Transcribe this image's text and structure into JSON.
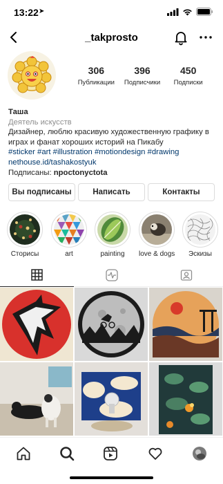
{
  "status": {
    "time": "13:22"
  },
  "header": {
    "username": "_takprosto"
  },
  "profile": {
    "stats": [
      {
        "value": "306",
        "label": "Публикации"
      },
      {
        "value": "396",
        "label": "Подписчики"
      },
      {
        "value": "450",
        "label": "Подписки"
      }
    ],
    "name": "Таша",
    "category": "Деятель искусств",
    "bio_line1": "Дизайнер, люблю красивую художественную графику в",
    "bio_line2": "играх и фанат хороших историй на Пикабу",
    "hashtags": "#sticker #art #illustration #motiondesign #drawing",
    "link": "nethouse.id/tashakostyuk",
    "followed_by_prefix": "Подписаны: ",
    "followed_by_user": "npoctonyctota"
  },
  "actions": {
    "following": "Вы подписаны",
    "message": "Написать",
    "contacts": "Контакты"
  },
  "highlights": [
    {
      "label": "Сторисы"
    },
    {
      "label": "art"
    },
    {
      "label": "painting"
    },
    {
      "label": "love & dogs"
    },
    {
      "label": "Эскизы"
    }
  ],
  "tabs": [
    {
      "icon": "grid-icon",
      "active": true
    },
    {
      "icon": "reels-icon",
      "active": false
    },
    {
      "icon": "tagged-icon",
      "active": false
    }
  ],
  "bottom_nav": [
    {
      "icon": "home-icon"
    },
    {
      "icon": "search-icon"
    },
    {
      "icon": "reels-icon"
    },
    {
      "icon": "heart-icon"
    },
    {
      "icon": "profile-avatar"
    }
  ],
  "colors": {
    "link": "#00376b",
    "muted": "#8e8e8e",
    "border": "#dbdbdb",
    "text": "#262626"
  }
}
